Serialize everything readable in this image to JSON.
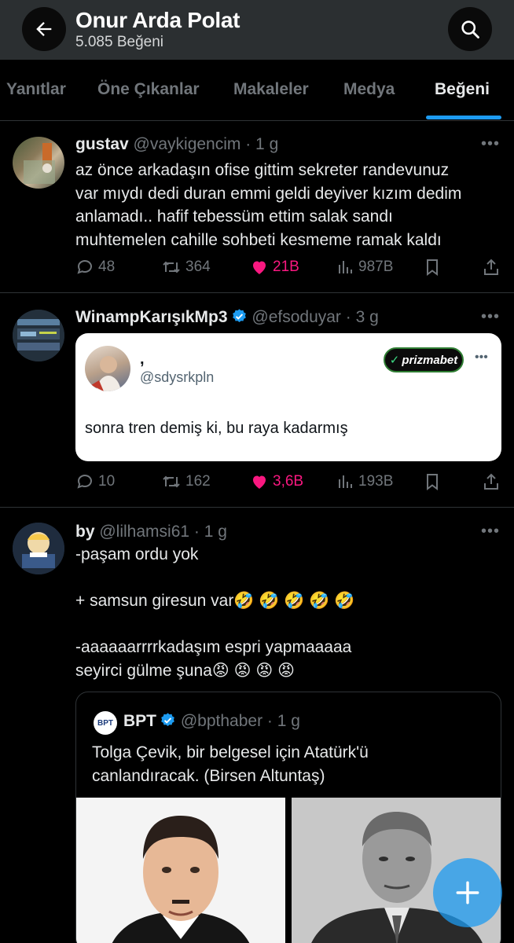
{
  "header": {
    "title": "Onur Arda Polat",
    "subtitle": "5.085 Beğeni"
  },
  "tabs": [
    {
      "label": "Yanıtlar"
    },
    {
      "label": "Öne Çıkanlar"
    },
    {
      "label": "Makaleler"
    },
    {
      "label": "Medya"
    },
    {
      "label": "Beğeni",
      "active": true
    }
  ],
  "tweets": [
    {
      "name": "gustav",
      "meta": "@vaykigencim · 1 g",
      "lines": [
        "az önce arkadaşın ofise gittim sekreter randevunuz",
        "var mıydı dedi duran emmi geldi deyiver kızım dedim",
        "anlamadı.. hafif tebessüm ettim salak sandı",
        "muhtemelen cahille sohbeti kesmeme ramak kaldı"
      ],
      "replies": "48",
      "reposts": "364",
      "likes": "21B",
      "views": "987B"
    },
    {
      "name": "WinampKarışıkMp3",
      "meta": "@efsoduyar · 3 g",
      "quote": {
        "name": ",",
        "handle": "@sdysrkpln",
        "brand": "prizmabet",
        "text": "sonra tren demiş ki, bu raya kadarmış"
      },
      "replies": "10",
      "reposts": "162",
      "likes": "3,6B",
      "views": "193B"
    },
    {
      "name": "by",
      "meta": "@lilhamsi61 · 1 g",
      "lines": [
        "-paşam ordu yok",
        "",
        "+ samsun giresun var🤣 🤣 🤣 🤣 🤣",
        "",
        "-aaaaaarrrrkadaşım espri yapmaaaaa",
        "seyirci gülme şuna😡 😡 😡 😡"
      ],
      "quote": {
        "name": "BPT",
        "meta": "@bpthaber · 1 g",
        "lines": [
          "Tolga Çevik, bir belgesel için Atatürk'ü",
          "canlandıracak. (Birsen Altuntaş)"
        ],
        "logo_text": "BPT"
      }
    }
  ],
  "icons": {
    "back": "arrow-left-icon",
    "search": "search-icon",
    "more": "more-icon",
    "reply": "reply-icon",
    "repost": "repost-icon",
    "like": "heart-icon",
    "views": "views-icon",
    "bookmark": "bookmark-icon",
    "share": "share-icon",
    "verified": "verified-icon",
    "compose": "plus-icon"
  },
  "colors": {
    "accent": "#1d9bf0",
    "like": "#f91880",
    "muted": "#71767b",
    "text": "#e7e9ea"
  }
}
